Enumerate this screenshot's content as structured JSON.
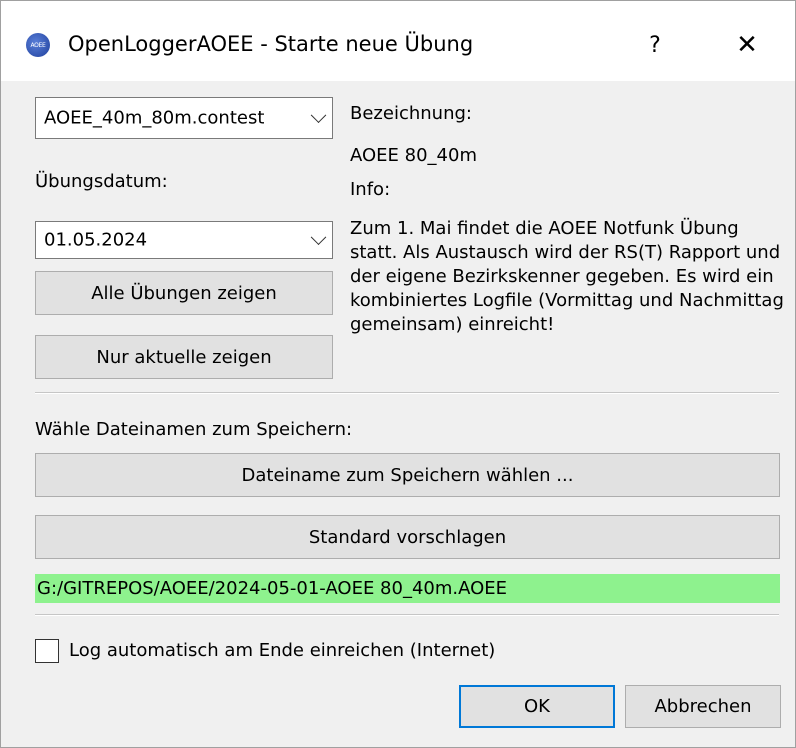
{
  "window": {
    "title": "OpenLoggerAOEE - Starte neue Übung",
    "icon": "aoee-logo-icon",
    "icon_text": "AOEE",
    "help": "?",
    "close": "✕"
  },
  "contest": {
    "selected": "AOEE_40m_80m.contest"
  },
  "date": {
    "label": "Übungsdatum:",
    "selected": "01.05.2024"
  },
  "buttons": {
    "show_all": "Alle Übungen zeigen",
    "show_current": "Nur aktuelle zeigen",
    "choose_filename": "Dateiname zum Speichern wählen ...",
    "suggest_default": "Standard vorschlagen",
    "ok": "OK",
    "cancel": "Abbrechen"
  },
  "details": {
    "name_label": "Bezeichnung:",
    "name_value": "AOEE 80_40m",
    "info_label": "Info:",
    "info_text": "Zum 1. Mai findet die AOEE Notfunk Übung statt. Als Austausch wird der RS(T) Rapport und der eigene Bezirkskenner gegeben. Es wird ein kombiniertes Logfile (Vormittag und Nachmittag gemeinsam) einreicht!"
  },
  "save": {
    "label": "Wähle Dateinamen zum Speichern:",
    "path": "G:/GITREPOS/AOEE/2024-05-01-AOEE 80_40m.AOEE",
    "path_bg": "#8ef28e"
  },
  "auto_submit": {
    "label": "Log automatisch am Ende einreichen (Internet)",
    "checked": false
  }
}
